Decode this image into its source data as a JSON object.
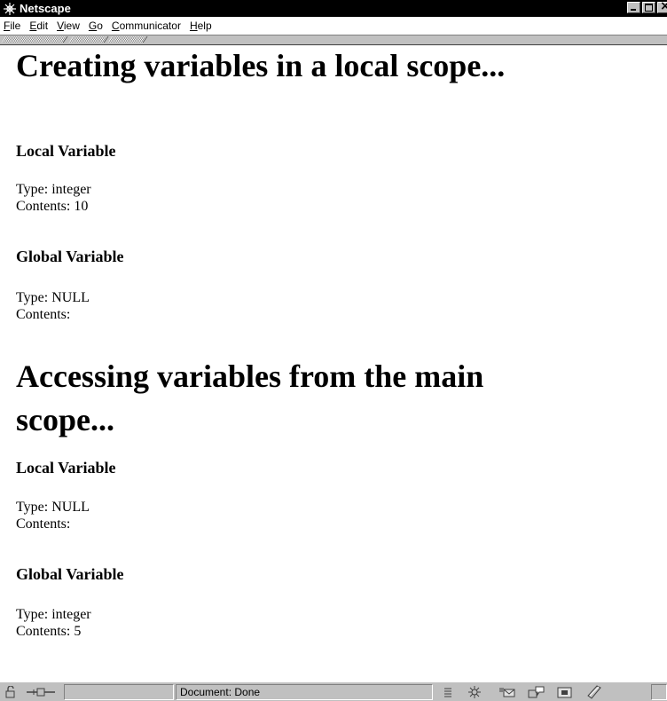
{
  "window": {
    "title": "Netscape"
  },
  "menu": [
    "File",
    "Edit",
    "View",
    "Go",
    "Communicator",
    "Help"
  ],
  "content": {
    "sections": [
      {
        "heading": "Creating variables in a local scope...",
        "blocks": [
          {
            "label": "Local Variable",
            "type_line": "Type: integer",
            "contents_line": "Contents: 10"
          },
          {
            "label": "Global Variable",
            "type_line": "Type: NULL",
            "contents_line": "Contents:"
          }
        ]
      },
      {
        "heading_line1": "Accessing variables from the main",
        "heading_line2": "scope...",
        "blocks": [
          {
            "label": "Local Variable",
            "type_line": "Type: NULL",
            "contents_line": "Contents:"
          },
          {
            "label": "Global Variable",
            "type_line": "Type: integer",
            "contents_line": "Contents: 5"
          }
        ]
      }
    ]
  },
  "status": {
    "text": "Document: Done"
  },
  "icons": {
    "app": "netscape-icon",
    "status": [
      "security-lock-icon",
      "connection-icon",
      "component-bar-icon",
      "navigator-icon",
      "mail-icon",
      "discussions-icon",
      "composer-icon",
      "edit-icon"
    ]
  }
}
